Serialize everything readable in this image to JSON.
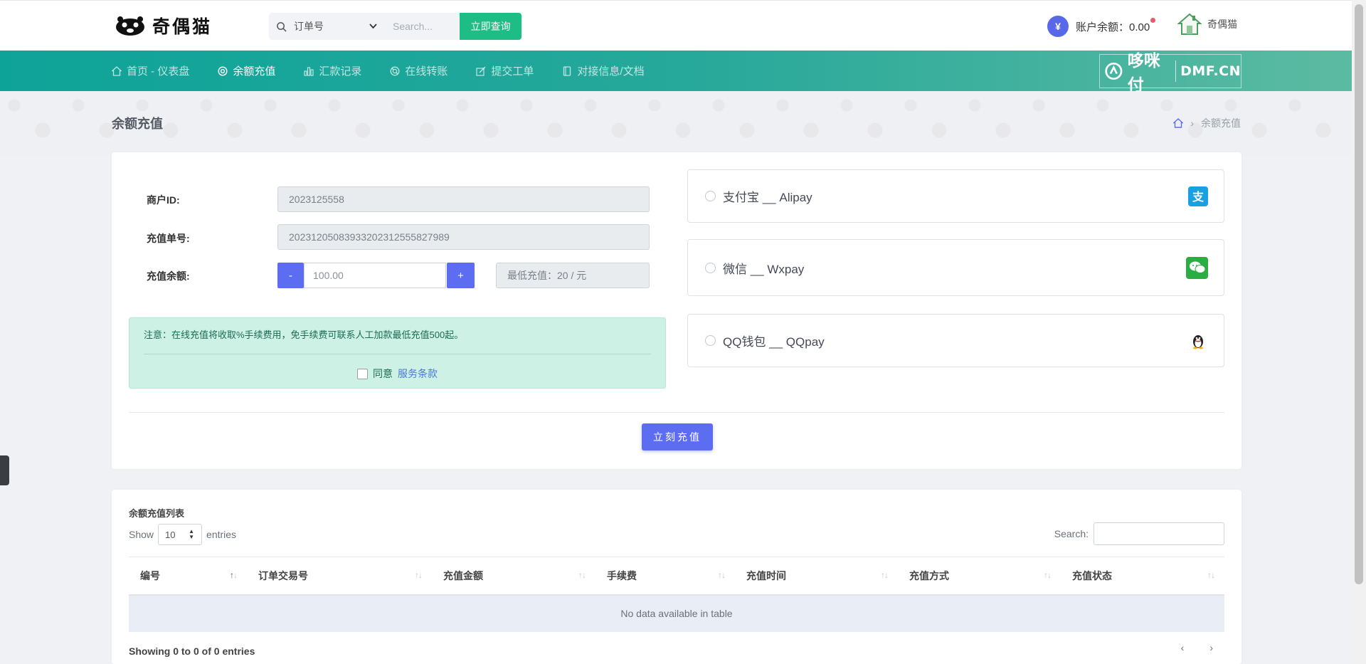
{
  "header": {
    "logo_text": "奇偶猫",
    "search_select": "订单号",
    "search_placeholder": "Search...",
    "search_button": "立即查询",
    "balance_label": "账户余额：0.00",
    "balance_icon": "¥",
    "user_name": "奇偶猫"
  },
  "nav": {
    "items": [
      {
        "label": "首页 - 仪表盘",
        "icon": "home-icon"
      },
      {
        "label": "余额充值",
        "icon": "target-icon",
        "active": true
      },
      {
        "label": "汇款记录",
        "icon": "bar-chart-icon"
      },
      {
        "label": "在线转账",
        "icon": "lifebuoy-icon"
      },
      {
        "label": "提交工单",
        "icon": "edit-icon"
      },
      {
        "label": "对接信息/文档",
        "icon": "book-icon"
      }
    ],
    "brand_cn": "哆咪付",
    "brand_en": "DMF.CN"
  },
  "page": {
    "title": "余额充值",
    "breadcrumb_current": "余额充值"
  },
  "form": {
    "merchant_label": "商户ID:",
    "merchant_value": "2023125558",
    "order_label": "充值单号:",
    "order_value": "20231205083933202312555827989",
    "amount_label": "充值余额:",
    "minus": "-",
    "amount_value": "100.00",
    "plus": "+",
    "min_recharge": "最低充值：20 / 元",
    "notice": "注意：在线充值将收取%手续费用，免手续费可联系人工加款最低充值500起。",
    "agree_text": "同意",
    "agree_link": "服务条款",
    "submit": "立刻充值"
  },
  "payments": [
    {
      "label": "支付宝 __ Alipay",
      "icon": "alipay-icon",
      "color": "#1a9fe0"
    },
    {
      "label": "微信 __ Wxpay",
      "icon": "wechat-icon",
      "color": "#2aae43"
    },
    {
      "label": "QQ钱包 __ QQpay",
      "icon": "qq-penguin-icon",
      "color": "#222222"
    }
  ],
  "table": {
    "title": "余额充值列表",
    "show_label": "Show",
    "length_value": "10",
    "entries_label": "entries",
    "search_label": "Search:",
    "columns": [
      "编号",
      "订单交易号",
      "充值金额",
      "手续费",
      "充值时间",
      "充值方式",
      "充值状态"
    ],
    "empty": "No data available in table",
    "info": "Showing 0 to 0 of 0 entries",
    "prev": "‹",
    "next": "›"
  },
  "colors": {
    "accent": "#5c6df2",
    "nav_start": "#0ea399",
    "nav_end": "#5dbba2",
    "search_button": "#1ebd86",
    "notice_bg": "#cdf1e5"
  }
}
